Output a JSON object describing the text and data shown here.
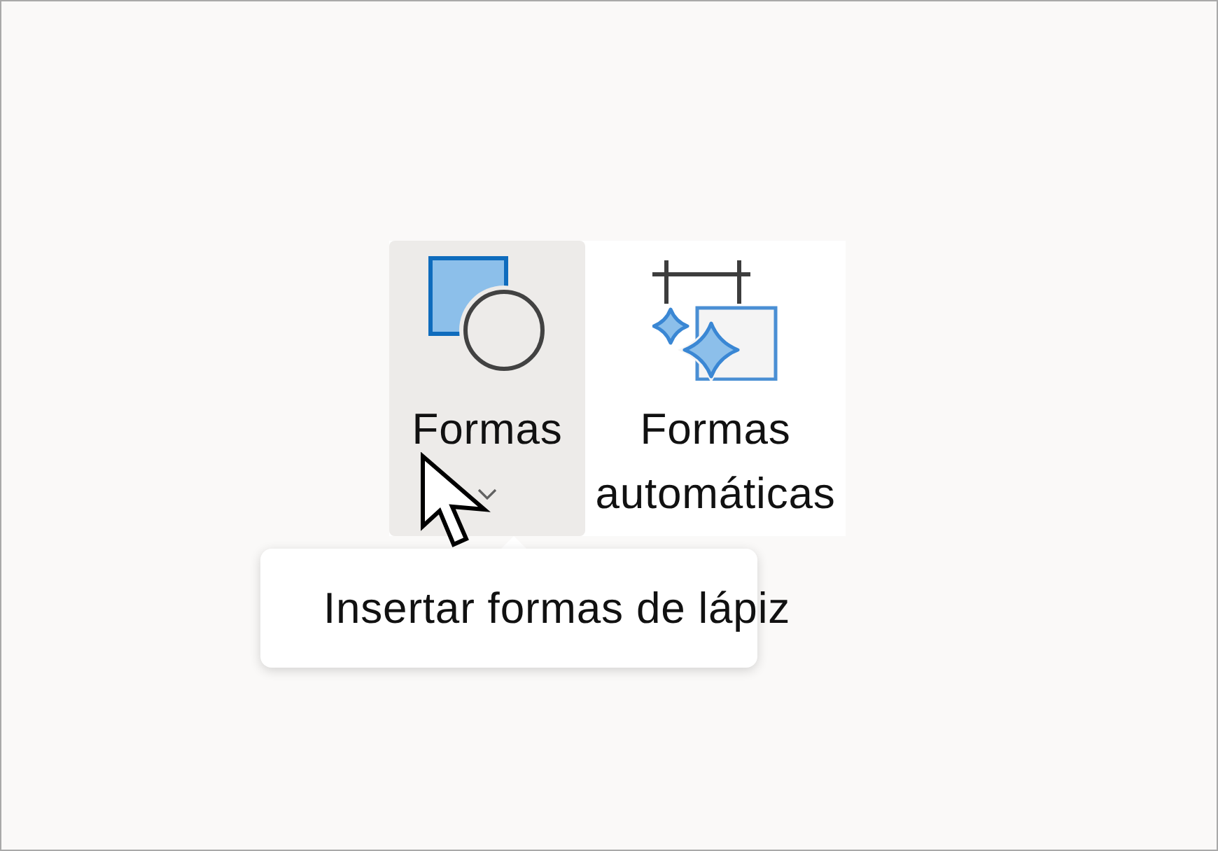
{
  "ribbon": {
    "buttons": [
      {
        "kind": "dropdown",
        "label": "Formas",
        "hovered": true
      },
      {
        "kind": "plain",
        "label": "Formas automáticas",
        "hovered": false
      }
    ]
  },
  "tooltip": {
    "text": "Insertar formas de lápiz"
  }
}
